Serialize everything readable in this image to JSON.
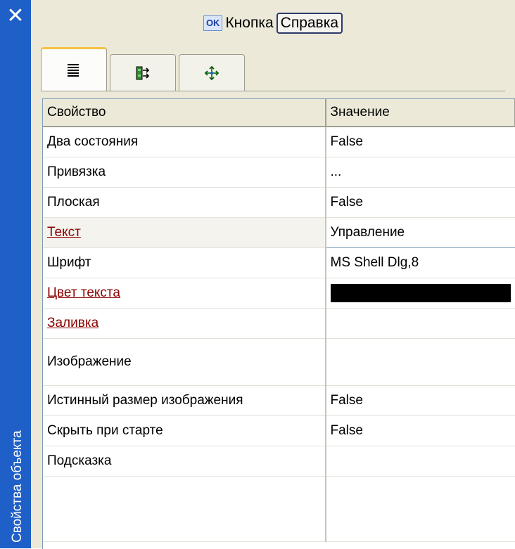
{
  "panel": {
    "title": "Свойства объекта",
    "close_glyph": "✕"
  },
  "object_header": {
    "icon_label": "OK",
    "type_label": "Кнопка",
    "help_label": "Справка"
  },
  "tabs": [
    {
      "icon": "properties-list-icon",
      "active": true
    },
    {
      "icon": "events-icon",
      "active": false
    },
    {
      "icon": "layout-arrows-icon",
      "active": false
    }
  ],
  "grid": {
    "headers": {
      "property": "Свойство",
      "value": "Значение"
    },
    "rows": [
      {
        "name": "Два состояния",
        "value": "False"
      },
      {
        "name": "Привязка",
        "value": "..."
      },
      {
        "name": "Плоская",
        "value": "False"
      },
      {
        "name": "Текст",
        "value": "Управление",
        "link": true,
        "selected": true
      },
      {
        "name": "Шрифт",
        "value": "MS Shell Dlg,8"
      },
      {
        "name": "Цвет текста",
        "value": "",
        "link": true,
        "color": "#000000"
      },
      {
        "name": "Заливка",
        "value": "",
        "link": true
      },
      {
        "name": "Изображение",
        "value": ""
      },
      {
        "name": "Истинный размер изображения",
        "value": "False"
      },
      {
        "name": "Скрыть при старте",
        "value": "False"
      },
      {
        "name": "Подсказка",
        "value": ""
      }
    ]
  },
  "colors": {
    "title_bar": "#1f5fc8",
    "panel_bg": "#ece9d8",
    "link_text": "#8b0000",
    "active_tab_accent": "#f5c242"
  }
}
